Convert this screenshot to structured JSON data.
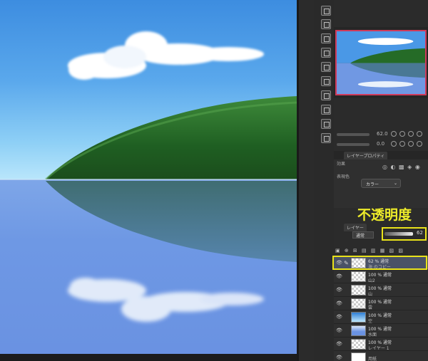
{
  "annotation": {
    "opacity_label": "不透明度"
  },
  "navigator": {
    "zoom_value": "62.0",
    "rotate_value": "0.0"
  },
  "property_panel": {
    "tabs": [
      "レイヤープロパティ"
    ],
    "effect_label": "効果",
    "expression_color_label": "表現色",
    "expression_color_value": "カラー"
  },
  "layer_panel": {
    "tab_label": "レイヤー",
    "blend_mode": "通常",
    "opacity": 62,
    "opacity_text": "62"
  },
  "layers": [
    {
      "mode": "62 % 通常",
      "name": "海 のコピー",
      "thumb": "checker",
      "selected": true
    },
    {
      "mode": "100 % 通常",
      "name": "山2",
      "thumb": "checker",
      "selected": false
    },
    {
      "mode": "100 % 通常",
      "name": "山",
      "thumb": "checker",
      "selected": false
    },
    {
      "mode": "100 % 通常",
      "name": "雲",
      "thumb": "checker",
      "selected": false
    },
    {
      "mode": "100 % 通常",
      "name": "空",
      "thumb": "sky",
      "selected": false
    },
    {
      "mode": "100 % 通常",
      "name": "水面",
      "thumb": "water",
      "selected": false
    },
    {
      "mode": "100 % 通常",
      "name": "レイヤー 1",
      "thumb": "checker",
      "selected": false
    },
    {
      "mode": "",
      "name": "用紙",
      "thumb": "white",
      "selected": false
    }
  ],
  "colors": {
    "highlight": "#e9e21a",
    "navigator_frame": "#d03a5a",
    "selected_layer": "#4a5266"
  }
}
